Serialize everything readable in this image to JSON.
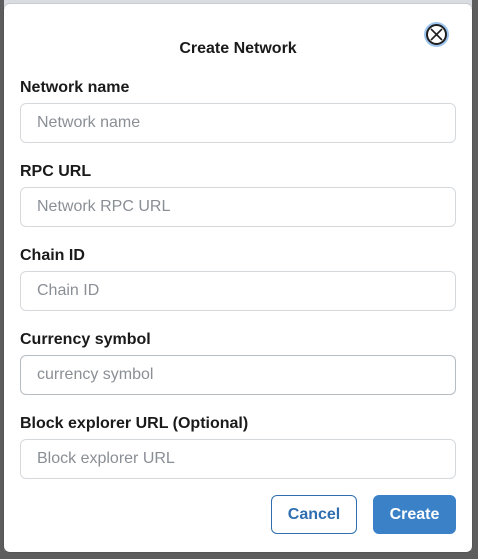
{
  "modal": {
    "title": "Create Network",
    "close_icon": "close-circle-icon"
  },
  "fields": [
    {
      "label": "Network name",
      "placeholder": "Network name",
      "value": ""
    },
    {
      "label": "RPC URL",
      "placeholder": "Network RPC URL",
      "value": ""
    },
    {
      "label": "Chain ID",
      "placeholder": "Chain ID",
      "value": ""
    },
    {
      "label": "Currency symbol",
      "placeholder": "currency symbol",
      "value": ""
    },
    {
      "label": "Block explorer URL (Optional)",
      "placeholder": "Block explorer URL",
      "value": ""
    }
  ],
  "actions": {
    "cancel_label": "Cancel",
    "create_label": "Create"
  },
  "colors": {
    "primary": "#3a81c8",
    "primary_border": "#2f6fb0",
    "overlay": "#6f6f6f"
  }
}
